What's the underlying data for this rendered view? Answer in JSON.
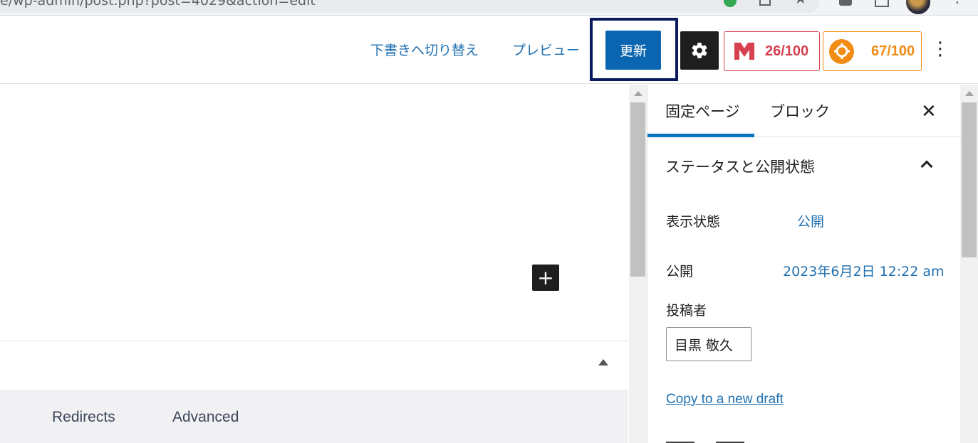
{
  "browser": {
    "url": "e/wp-admin/post.php?post=4029&action=edit"
  },
  "header": {
    "switch_to_draft": "下書きへ切り替え",
    "preview": "プレビュー",
    "update": "更新",
    "settings_icon": "gear-icon",
    "score_1": "26/100",
    "score_2": "67/100",
    "more_icon": "more-vertical-icon"
  },
  "editor": {
    "inserter_icon": "plus-icon",
    "meta_tabs": [
      "Redirects",
      "Advanced"
    ]
  },
  "sidebar": {
    "tabs": [
      "固定ページ",
      "ブロック"
    ],
    "close_icon": "close-icon",
    "panel_title": "ステータスと公開状態",
    "visibility_label": "表示状態",
    "visibility_value": "公開",
    "publish_label": "公開",
    "publish_value": "2023年6月2日 12:22 am",
    "author_label": "投稿者",
    "author_value": "目黒 敬久",
    "copy_link": "Copy to a new draft"
  },
  "colors": {
    "accent": "#2271b1",
    "update_button": "#0a66b0",
    "highlight_frame": "#0b1a5c",
    "score_red": "#d6404f",
    "score_orange": "#f28c14"
  }
}
